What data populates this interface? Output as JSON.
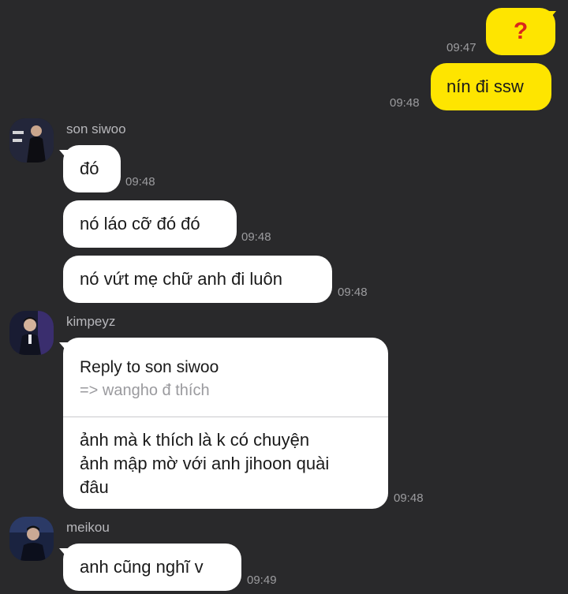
{
  "outgoing": [
    {
      "text": "?",
      "time": "09:47",
      "accent": "#d9261c"
    },
    {
      "text": "nín đi ssw",
      "time": "09:48"
    }
  ],
  "groups": [
    {
      "sender": "son siwoo",
      "avatar_icon": "profile-photo-icon",
      "messages": [
        {
          "text": "đó",
          "time": "09:48"
        },
        {
          "text": "nó láo cỡ đó đó",
          "time": "09:48"
        },
        {
          "text": "nó vứt mẹ chữ anh đi luôn",
          "time": "09:48"
        }
      ]
    },
    {
      "sender": "kimpeyz",
      "avatar_icon": "profile-photo-icon",
      "reply": {
        "heading": "Reply to son siwoo",
        "quote": "=> wangho đ thích",
        "lines": [
          "ảnh mà k thích là k có chuyện",
          "ảnh mập mờ với anh jihoon quài",
          "đâu"
        ],
        "time": "09:48"
      }
    },
    {
      "sender": "meikou",
      "avatar_icon": "profile-photo-icon",
      "messages": [
        {
          "text": "anh cũng nghĩ v",
          "time": "09:49"
        }
      ]
    }
  ],
  "colors": {
    "background": "#29292b",
    "incoming_bubble": "#ffffff",
    "outgoing_bubble": "#fee500",
    "timestamp": "#9c9c9f",
    "sender_name": "#b7b7bb"
  }
}
